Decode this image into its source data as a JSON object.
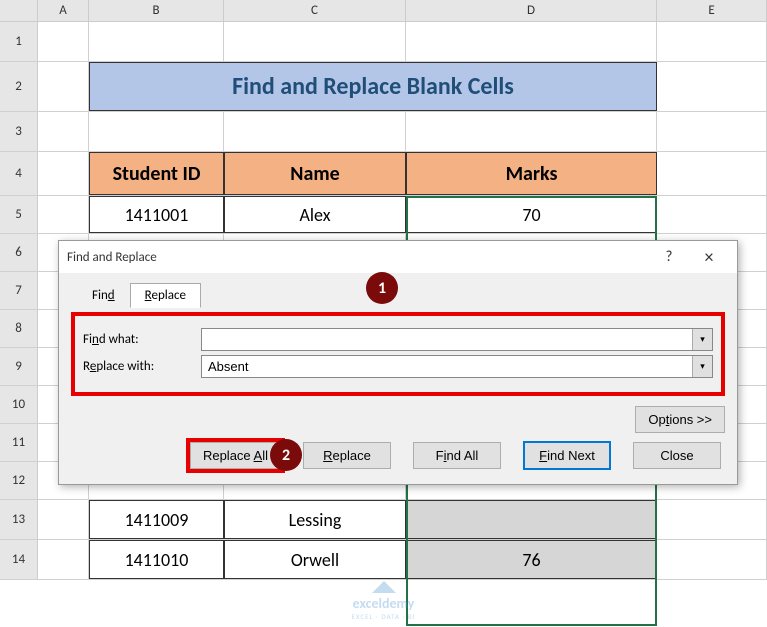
{
  "columns": {
    "a": "A",
    "b": "B",
    "c": "C",
    "d": "D",
    "e": "E"
  },
  "rows": [
    "1",
    "2",
    "3",
    "4",
    "5",
    "6",
    "7",
    "8",
    "9",
    "10",
    "11",
    "12",
    "13",
    "14"
  ],
  "title": "Find and Replace Blank Cells",
  "headers": {
    "id": "Student ID",
    "name": "Name",
    "marks": "Marks"
  },
  "data": {
    "r5": {
      "id": "1411001",
      "name": "Alex",
      "marks": "70"
    },
    "r13": {
      "id": "1411009",
      "name": "Lessing",
      "marks": ""
    },
    "r14": {
      "id": "1411010",
      "name": "Orwell",
      "marks": "76"
    }
  },
  "dialog": {
    "title": "Find and Replace",
    "help": "?",
    "close": "×",
    "tabs": {
      "find": {
        "pre": "Fin",
        "u": "d"
      },
      "replace": {
        "u": "R",
        "post": "eplace"
      }
    },
    "find_label_pre": "Fi",
    "find_label_u": "n",
    "find_label_post": "d what:",
    "replace_label_pre": "R",
    "replace_label_u": "e",
    "replace_label_post": "place with:",
    "find_value": "",
    "replace_value": "Absent",
    "options": {
      "pre": "Op",
      "u": "t",
      "post": "ions >>"
    },
    "buttons": {
      "replace_all": {
        "pre": "Replace ",
        "u": "A",
        "post": "ll"
      },
      "replace": {
        "u": "R",
        "post": "eplace"
      },
      "find_all": {
        "pre": "F",
        "u": "i",
        "post": "nd All"
      },
      "find_next": {
        "u": "F",
        "post": "ind Next"
      },
      "close": "Close"
    }
  },
  "badges": {
    "b1": "1",
    "b2": "2"
  },
  "watermark": {
    "brand": "exceldemy",
    "tag": "EXCEL · DATA · BI"
  }
}
